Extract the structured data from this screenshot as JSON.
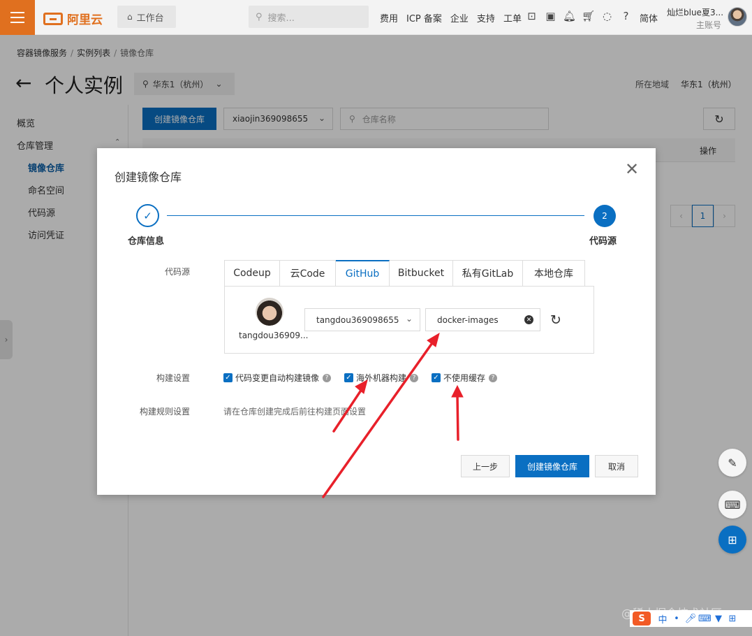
{
  "topbar": {
    "brand": "阿里云",
    "workbench": "工作台",
    "search_placeholder": "搜索...",
    "nav": [
      "费用",
      "ICP 备案",
      "企业",
      "支持",
      "工单"
    ],
    "language": "简体",
    "user_name": "灿烂blue夏3...",
    "user_role": "主账号"
  },
  "breadcrumb": [
    "容器镜像服务",
    "实例列表",
    "镜像仓库"
  ],
  "page": {
    "title": "个人实例",
    "region": "华东1（杭州）",
    "region_label": "所在地域",
    "region_value": "华东1（杭州）"
  },
  "leftnav": {
    "items": [
      "概览",
      "仓库管理",
      "镜像仓库",
      "命名空间",
      "代码源",
      "访问凭证"
    ],
    "active": "镜像仓库"
  },
  "background": {
    "create_button": "创建镜像仓库",
    "namespace": "xiaojin369098655",
    "repo_search_placeholder": "仓库名称",
    "op_header": "操作",
    "page_num": "1"
  },
  "dialog": {
    "title": "创建镜像仓库",
    "steps": [
      {
        "label": "仓库信息",
        "state": "done"
      },
      {
        "label": "代码源",
        "number": "2",
        "state": "current"
      }
    ],
    "source_label": "代码源",
    "tabs": [
      "Codeup",
      "云Code",
      "GitHub",
      "Bitbucket",
      "私有GitLab",
      "本地仓库"
    ],
    "active_tab": "GitHub",
    "repo_user": "tangdou36909...",
    "account_select": "tangdou369098655",
    "repo_input": "docker-images",
    "build_label": "构建设置",
    "build_options": [
      {
        "label": "代码变更自动构建镜像",
        "checked": true
      },
      {
        "label": "海外机器构建",
        "checked": true
      },
      {
        "label": "不使用缓存",
        "checked": true
      }
    ],
    "rule_label": "构建规则设置",
    "rule_text": "请在仓库创建完成后前往构建页面设置",
    "buttons": {
      "prev": "上一步",
      "create": "创建镜像仓库",
      "cancel": "取消"
    }
  },
  "watermark": "@稀土掘金技术社区",
  "ime": {
    "logo": "S",
    "mode": "中"
  },
  "colors": {
    "accent": "#0a6fc2",
    "brand": "#e0701f",
    "annotation": "#e8202a"
  }
}
